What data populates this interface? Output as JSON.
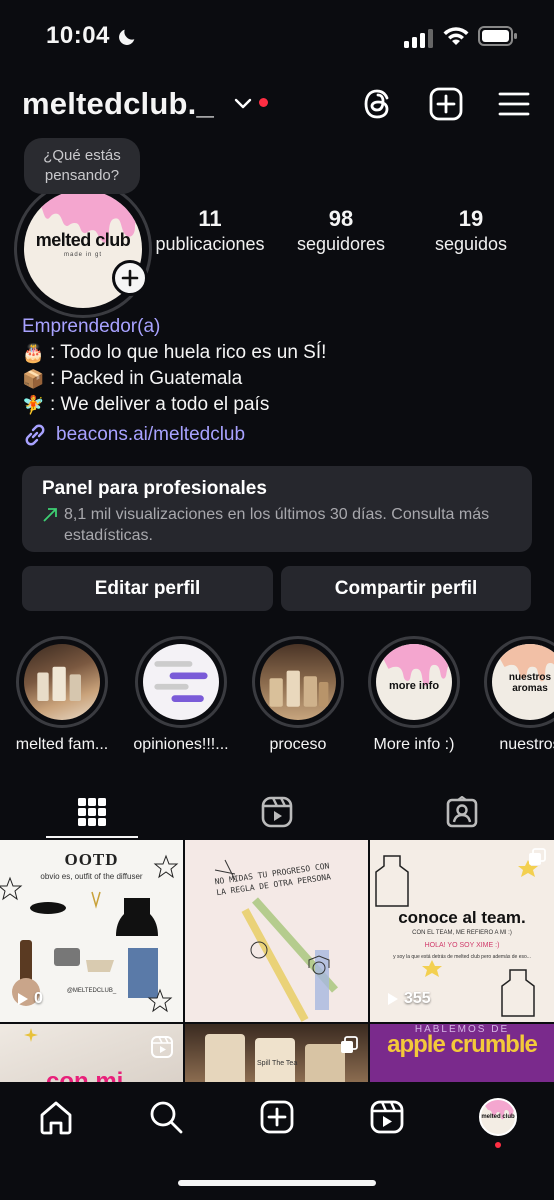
{
  "status": {
    "time": "10:04"
  },
  "header": {
    "username": "meltedclub._"
  },
  "profile": {
    "note": "¿Qué estás pensando?",
    "avatar_text": "melted club",
    "avatar_subtext": "made in gt",
    "stats": [
      {
        "value": "11",
        "label": "publicaciones"
      },
      {
        "value": "98",
        "label": "seguidores"
      },
      {
        "value": "19",
        "label": "seguidos"
      }
    ],
    "category": "Emprendedor(a)",
    "bio": [
      {
        "emoji": "🎂",
        "text": ": Todo lo que huela rico es un SÍ!"
      },
      {
        "emoji": "📦",
        "text": ": Packed in Guatemala"
      },
      {
        "emoji": "🧚",
        "text": ": We deliver a todo el país"
      }
    ],
    "link": "beacons.ai/meltedclub"
  },
  "panel": {
    "title": "Panel para profesionales",
    "desc": "8,1 mil visualizaciones en los últimos 30 días. Consulta más estadísticas."
  },
  "buttons": {
    "edit": "Editar perfil",
    "share": "Compartir perfil"
  },
  "highlights": [
    {
      "label": "melted fam..."
    },
    {
      "label": "opiniones!!!..."
    },
    {
      "label": "proceso"
    },
    {
      "label": "More info :)",
      "cover_text": "more info"
    },
    {
      "label": "nuestros",
      "cover_text": "nuestros aromas"
    }
  ],
  "grid": [
    {
      "title": "OOTD",
      "subtitle": "obvio es, outfit of the diffuser",
      "count": "0",
      "handle": "@MELTEDCLUB_"
    },
    {
      "text": "NO MIDAS TU PROGRESO CON LA REGLA DE OTRA PERSONA"
    },
    {
      "title": "conoce al team.",
      "subtitle": "CON EL TEAM, ME REFIERO A MI :)",
      "greeting": "HOLA! YO SOY XIME :)",
      "detail": "y soy la que está detrás de melted club pero además de eso...",
      "count": "355"
    },
    {
      "text": "con mi"
    },
    {
      "text": "Spill The Tea"
    },
    {
      "top": "HABLEMOS DE",
      "title": "apple crumble"
    }
  ],
  "colors": {
    "accent_link": "#a8a2ff",
    "notification": "#ff2e43",
    "background": "#0b0c10",
    "card": "#26272d"
  }
}
